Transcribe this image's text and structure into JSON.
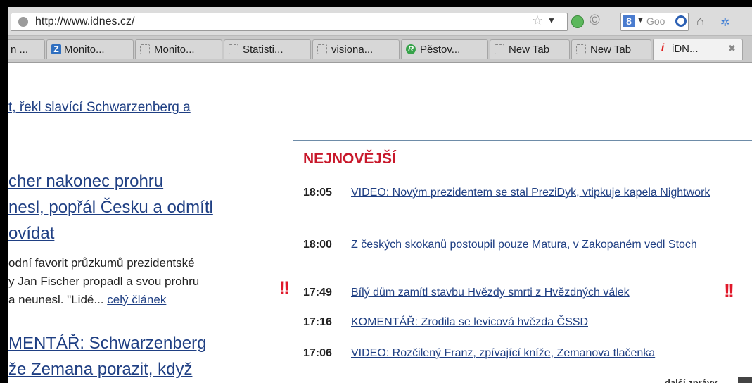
{
  "browser": {
    "url": "http://www.idnes.cz/",
    "search_placeholder": "Goo"
  },
  "tabs": [
    {
      "label": "n ...",
      "icon": "none"
    },
    {
      "label": "Monito...",
      "icon": "z-logo-icon"
    },
    {
      "label": "Monito...",
      "icon": "blank-page-icon"
    },
    {
      "label": "Statisti...",
      "icon": "blank-page-icon"
    },
    {
      "label": "visiona...",
      "icon": "blank-page-icon"
    },
    {
      "label": "Pěstov...",
      "icon": "r-logo-icon"
    },
    {
      "label": "New Tab",
      "icon": "blank-page-icon"
    },
    {
      "label": "New Tab",
      "icon": "blank-page-icon"
    },
    {
      "label": "iDN...",
      "icon": "idnes-icon",
      "active": true
    }
  ],
  "left": {
    "lead_link": "t, řekl slavící Schwarzenberg a",
    "story_title_lines": [
      "cher nakonec prohru",
      "nesl, popřál Česku a odmítl",
      "ovídat"
    ],
    "story_text_lines": [
      "odní favorit průzkumů prezidentské",
      "y Jan Fischer propadl a svou prohru",
      "a neunesl. \"Lidé... "
    ],
    "story_more": "celý článek",
    "komentar_lines": [
      "MENTÁŘ: Schwarzenberg",
      "že Zemana porazit, když"
    ]
  },
  "right": {
    "heading": "NEJNOVĚJŠÍ",
    "news": [
      {
        "time": "18:05",
        "text": "VIDEO: Novým prezidentem se stal PreziDyk, vtipkuje kapela Nightwork"
      },
      {
        "time": "18:00",
        "text": "Z českých skokanů postoupil pouze Matura, v Zakopaném vedl Stoch"
      },
      {
        "time": "17:49",
        "text": "Bílý dům zamítl stavbu Hvězdy smrti z Hvězdných válek",
        "flag": "!!"
      },
      {
        "time": "17:16",
        "text": "KOMENTÁŘ: Zrodila se levicová hvězda ČSSD"
      },
      {
        "time": "17:06",
        "text": "VIDEO: Rozčilený Franz, zpívající kníže, Zemanova tlačenka"
      }
    ],
    "more_news": "další zprávy"
  },
  "colors": {
    "heading_red": "#c8182b",
    "link_blue": "#1f3f83",
    "alert_red": "#e0182a"
  }
}
